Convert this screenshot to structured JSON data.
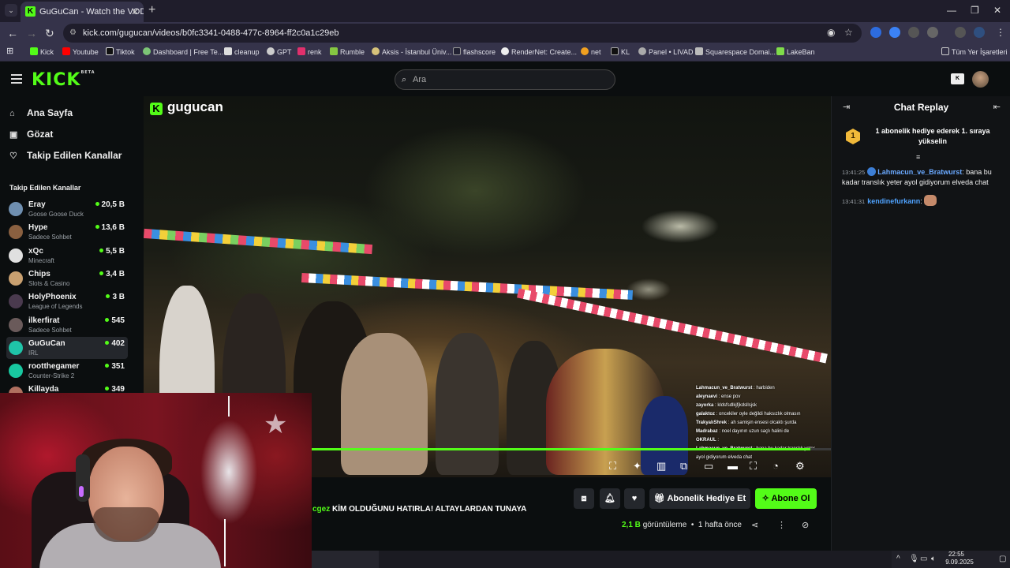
{
  "browser": {
    "tab_title": "GuGuCan - Watch the VOD on",
    "url": "kick.com/gugucan/videos/b0fc3341-0488-477c-8964-ff2c0a1c29eb",
    "bookmarks": [
      "Kick",
      "Youtube",
      "Tiktok",
      "Dashboard | Free Te...",
      "cleanup",
      "GPT",
      "renk",
      "Rumble",
      "Aksis - İstanbul Üniv...",
      "flashscore",
      "RenderNet: Create...",
      "net",
      "KL",
      "Panel • LIVAD",
      "Squarespace Domai...",
      "LakeBan"
    ],
    "all_bookmarks": "Tüm Yer İşaretleri"
  },
  "header": {
    "logo": "KICK",
    "logo_badge": "BETA",
    "search_placeholder": "Ara"
  },
  "sidebar": {
    "nav": [
      {
        "label": "Ana Sayfa",
        "icon": "home-icon"
      },
      {
        "label": "Gözat",
        "icon": "browse-icon"
      },
      {
        "label": "Takip Edilen Kanallar",
        "icon": "heart-icon"
      }
    ],
    "followed_heading": "Takip Edilen Kanallar",
    "channels": [
      {
        "name": "Eray",
        "category": "Goose Goose Duck",
        "viewers": "20,5 B",
        "color": "#6f8fb0"
      },
      {
        "name": "Hype",
        "category": "Sadece Sohbet",
        "viewers": "13,6 B",
        "color": "#8a6040"
      },
      {
        "name": "xQc",
        "category": "Minecraft",
        "viewers": "5,5 B",
        "color": "#e0e0e0"
      },
      {
        "name": "Chips",
        "category": "Slots & Casino",
        "viewers": "3,4 B",
        "color": "#c9a070"
      },
      {
        "name": "HolyPhoenix",
        "category": "League of Legends",
        "viewers": "3 B",
        "color": "#4a3a4e"
      },
      {
        "name": "ilkerfirat",
        "category": "Sadece Sohbet",
        "viewers": "545",
        "color": "#6a5a5a"
      },
      {
        "name": "GuGuCan",
        "category": "IRL",
        "viewers": "402",
        "color": "#1fc4a8"
      },
      {
        "name": "rootthegamer",
        "category": "Counter-Strike 2",
        "viewers": "351",
        "color": "#18c8a0"
      },
      {
        "name": "Killayda",
        "category": "",
        "viewers": "349",
        "color": "#b07060"
      }
    ]
  },
  "video": {
    "channel_watermark": "gugucan",
    "progress": 0.97,
    "overlay_chat": [
      {
        "user": "Lahmacun_ve_Bratwurst",
        "text": "harbiden"
      },
      {
        "user": "aleynaevi",
        "text": "ense pov"
      },
      {
        "user": "zayorka",
        "text": "kldsfsdlkjfjkdsllsjsk"
      },
      {
        "user": "galaktoz",
        "text": "oncekiler oyle değildi haksızlık olmasın"
      },
      {
        "user": "TrakyalıShrek",
        "text": "ah samişin ensesi olcaktı şurda"
      },
      {
        "user": "Madrabaz",
        "text": "noel dayının uzun saçlı halini de"
      },
      {
        "user": "OKRAUL",
        "text": ""
      },
      {
        "user": "Lahmacun_ve_Bratwurst",
        "text": "bana bu kadar translık yeter ayol gidiyorum elveda chat"
      }
    ]
  },
  "chat": {
    "title": "Chat Replay",
    "pinned_rank": "1",
    "pinned_text": "1 abonelik hediye ederek 1. sıraya yükselin",
    "messages": [
      {
        "time": "13:41:25",
        "user": "Lahmacun_ve_Bratwurst",
        "text": "bana bu kadar translık yeter ayol gidiyorum elveda chat"
      },
      {
        "time": "13:41:31",
        "user": "kendinefurkann",
        "text": ""
      }
    ]
  },
  "below": {
    "title_prefix": "cgez",
    "title": "KİM OLDUĞUNU HATIRLA! ALTAYLARDAN TUNAYA",
    "gift_button": "Abonelik Hediye Et",
    "subscribe_button": "Abone Ol",
    "views": "2,1 B",
    "views_label": "görüntüleme",
    "posted": "1 hafta önce",
    "separator": "•"
  },
  "taskbar": {
    "time": "22:55",
    "date": "9.09.2025"
  }
}
